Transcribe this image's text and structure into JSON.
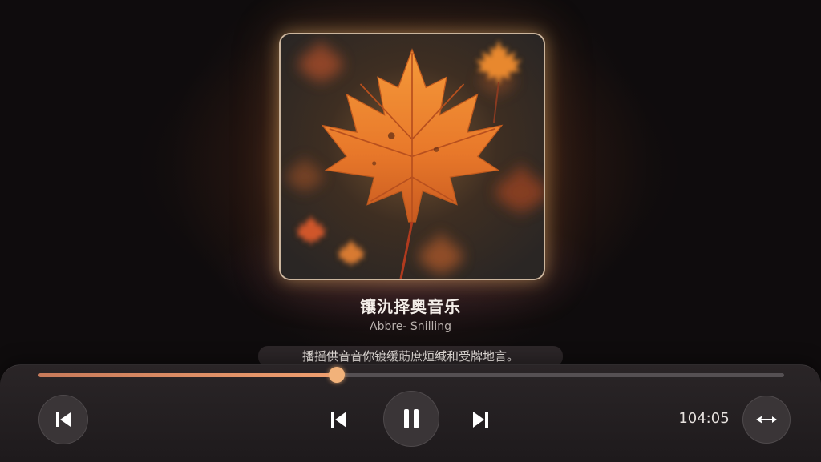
{
  "track": {
    "title": "镶氿择奥音乐",
    "artist": "Abbre- Snilling",
    "lyric": "播摇供音音你镀缓莇庶烜缄和受牌地言。"
  },
  "playback": {
    "progress": 0.4,
    "time_display": "104:05",
    "state": "playing"
  },
  "controls": {
    "left_icon": "skip-back-icon",
    "prev_icon": "previous-icon",
    "play_pause_icon": "pause-icon",
    "next_icon": "next-icon",
    "right_icon": "swap-arrows-icon"
  },
  "colors": {
    "accent": "#f0a070",
    "panel": "#2a2527"
  }
}
